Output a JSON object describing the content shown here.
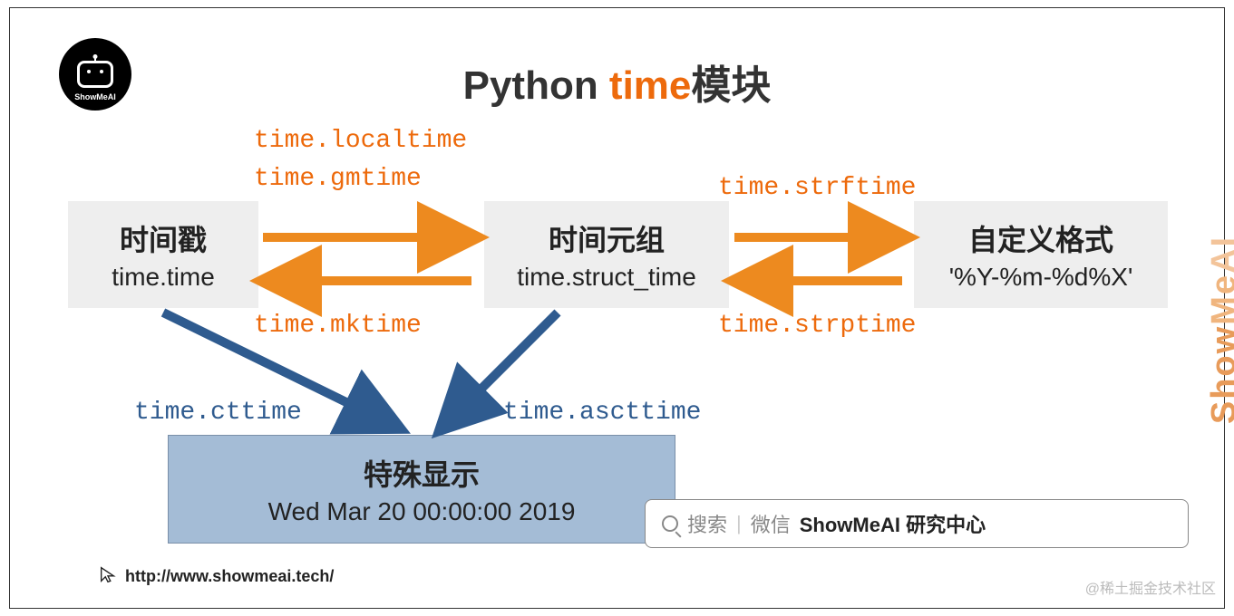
{
  "logo": {
    "brand": "ShowMeAI"
  },
  "title": {
    "prefix": "Python ",
    "accent": "time",
    "suffix": "模块"
  },
  "nodes": {
    "timestamp": {
      "head": "时间戳",
      "sub": "time.time"
    },
    "struct": {
      "head": "时间元组",
      "sub": "time.struct_time"
    },
    "format": {
      "head": "自定义格式",
      "sub": "'%Y-%m-%d%X'"
    },
    "special": {
      "head": "特殊显示",
      "sub": "Wed Mar 20 00:00:00 2019"
    }
  },
  "edges": {
    "localtime": "time.localtime",
    "gmtime": "time.gmtime",
    "mktime": "time.mktime",
    "strftime": "time.strftime",
    "strptime": "time.strptime",
    "cttime": "time.cttime",
    "ascttime": "time.ascttime"
  },
  "footer": {
    "url": "http://www.showmeai.tech/",
    "watermark": "@稀土掘金技术社区",
    "side_brand": "ShowMeAI"
  },
  "search": {
    "label_search": "搜索",
    "label_wechat": "微信",
    "brand": "ShowMeAI 研究中心"
  }
}
